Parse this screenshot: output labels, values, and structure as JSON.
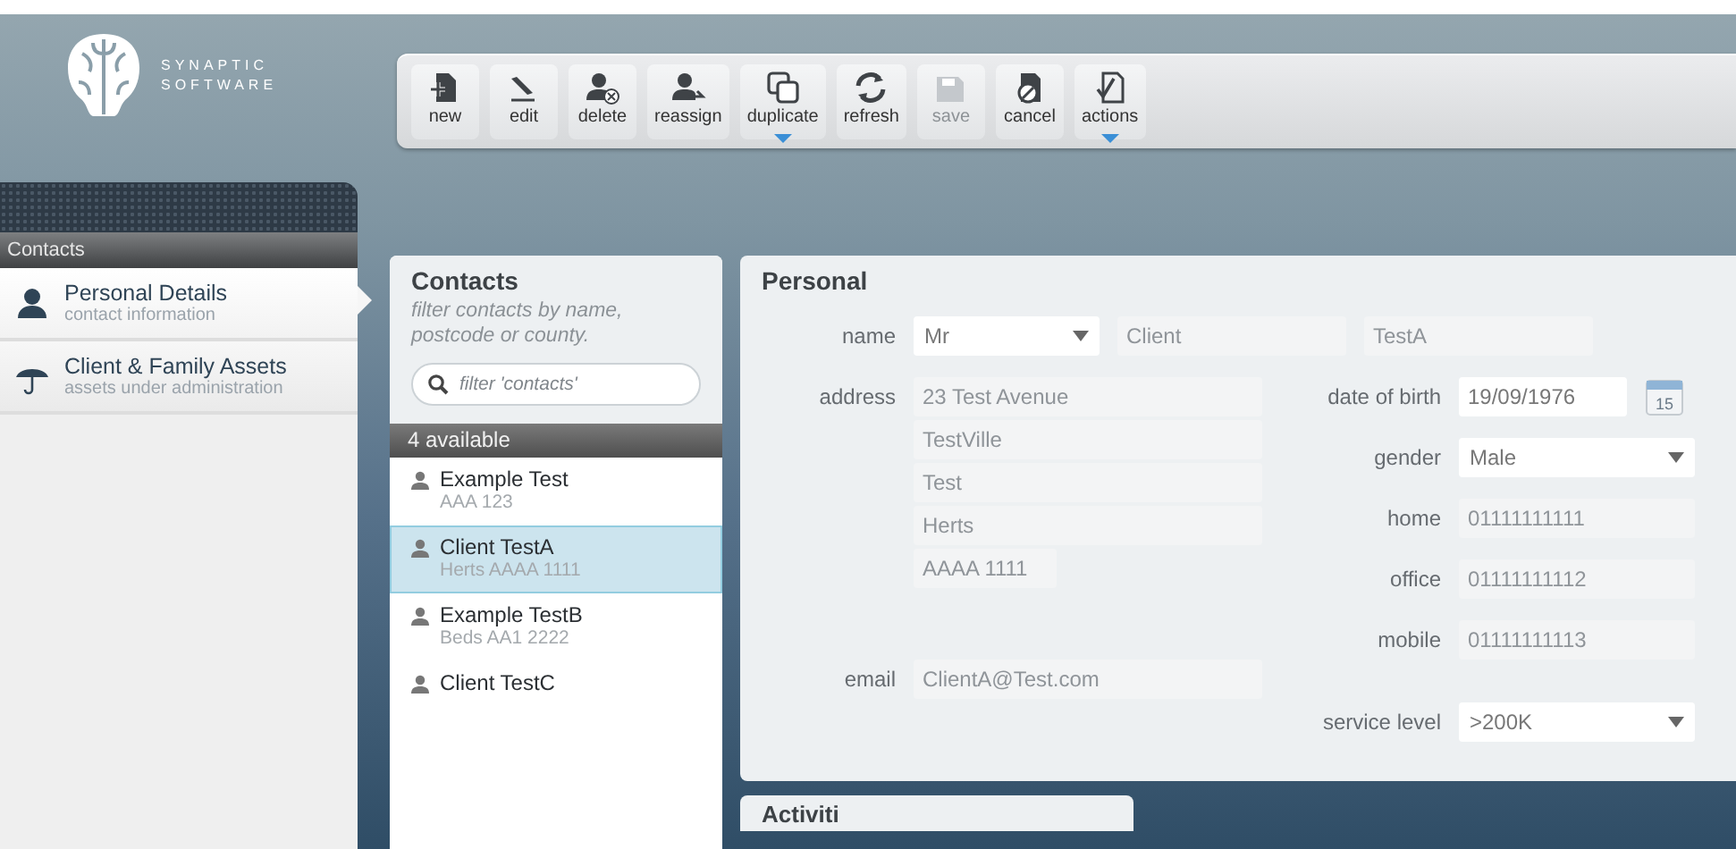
{
  "logo": {
    "line1": "SYNAPTIC",
    "line2": "SOFTWARE"
  },
  "toolbar": [
    {
      "label": "new",
      "kind": "new",
      "disabled": false,
      "has_menu": false
    },
    {
      "label": "edit",
      "kind": "edit",
      "disabled": false,
      "has_menu": false
    },
    {
      "label": "delete",
      "kind": "delete",
      "disabled": false,
      "has_menu": false
    },
    {
      "label": "reassign",
      "kind": "reassign",
      "disabled": false,
      "has_menu": false
    },
    {
      "label": "duplicate",
      "kind": "duplicate",
      "disabled": false,
      "has_menu": true
    },
    {
      "label": "refresh",
      "kind": "refresh",
      "disabled": false,
      "has_menu": false
    },
    {
      "label": "save",
      "kind": "save",
      "disabled": true,
      "has_menu": false
    },
    {
      "label": "cancel",
      "kind": "cancel",
      "disabled": false,
      "has_menu": false
    },
    {
      "label": "actions",
      "kind": "actions",
      "disabled": false,
      "has_menu": true
    }
  ],
  "sidebar": {
    "header": "Contacts",
    "items": [
      {
        "title": "Personal Details",
        "subtitle": "contact information",
        "kind": "person",
        "selected": true
      },
      {
        "title": "Client & Family Assets",
        "subtitle": "assets under administration",
        "kind": "umbrella",
        "selected": false
      }
    ]
  },
  "contacts": {
    "title": "Contacts",
    "hint": "filter contacts by name, postcode or county.",
    "search": {
      "placeholder": "filter 'contacts'"
    },
    "count": "4 available",
    "items": [
      {
        "name": "Example Test",
        "detail": "AAA 123",
        "selected": false
      },
      {
        "name": "Client TestA",
        "detail": "Herts AAAA 1111",
        "selected": true
      },
      {
        "name": "Example TestB",
        "detail": "Beds AA1 2222",
        "selected": false
      },
      {
        "name": "Client TestC",
        "selected": false
      }
    ]
  },
  "personal": {
    "title": "Personal",
    "name": {
      "label": "name",
      "title": "Mr",
      "first": "Client",
      "last": "TestA"
    },
    "address": {
      "label": "address",
      "lines": [
        "23 Test Avenue",
        "TestVille",
        "Test",
        "Herts",
        "AAAA 1111"
      ]
    },
    "email": {
      "label": "email",
      "value": "ClientA@Test.com"
    },
    "right_fields": [
      {
        "label": "date of birth",
        "value": "19/09/1976",
        "kind": "date",
        "calendar_day": "15"
      },
      {
        "label": "gender",
        "value": "Male",
        "kind": "select"
      },
      {
        "label": "home",
        "value": "01111111111",
        "kind": "text"
      },
      {
        "label": "office",
        "value": "01111111112",
        "kind": "text"
      },
      {
        "label": "mobile",
        "value": "01111111113",
        "kind": "text"
      }
    ],
    "service_level": {
      "label": "service level",
      "value": ">200K"
    }
  },
  "activities": {
    "title": "Activiti"
  }
}
